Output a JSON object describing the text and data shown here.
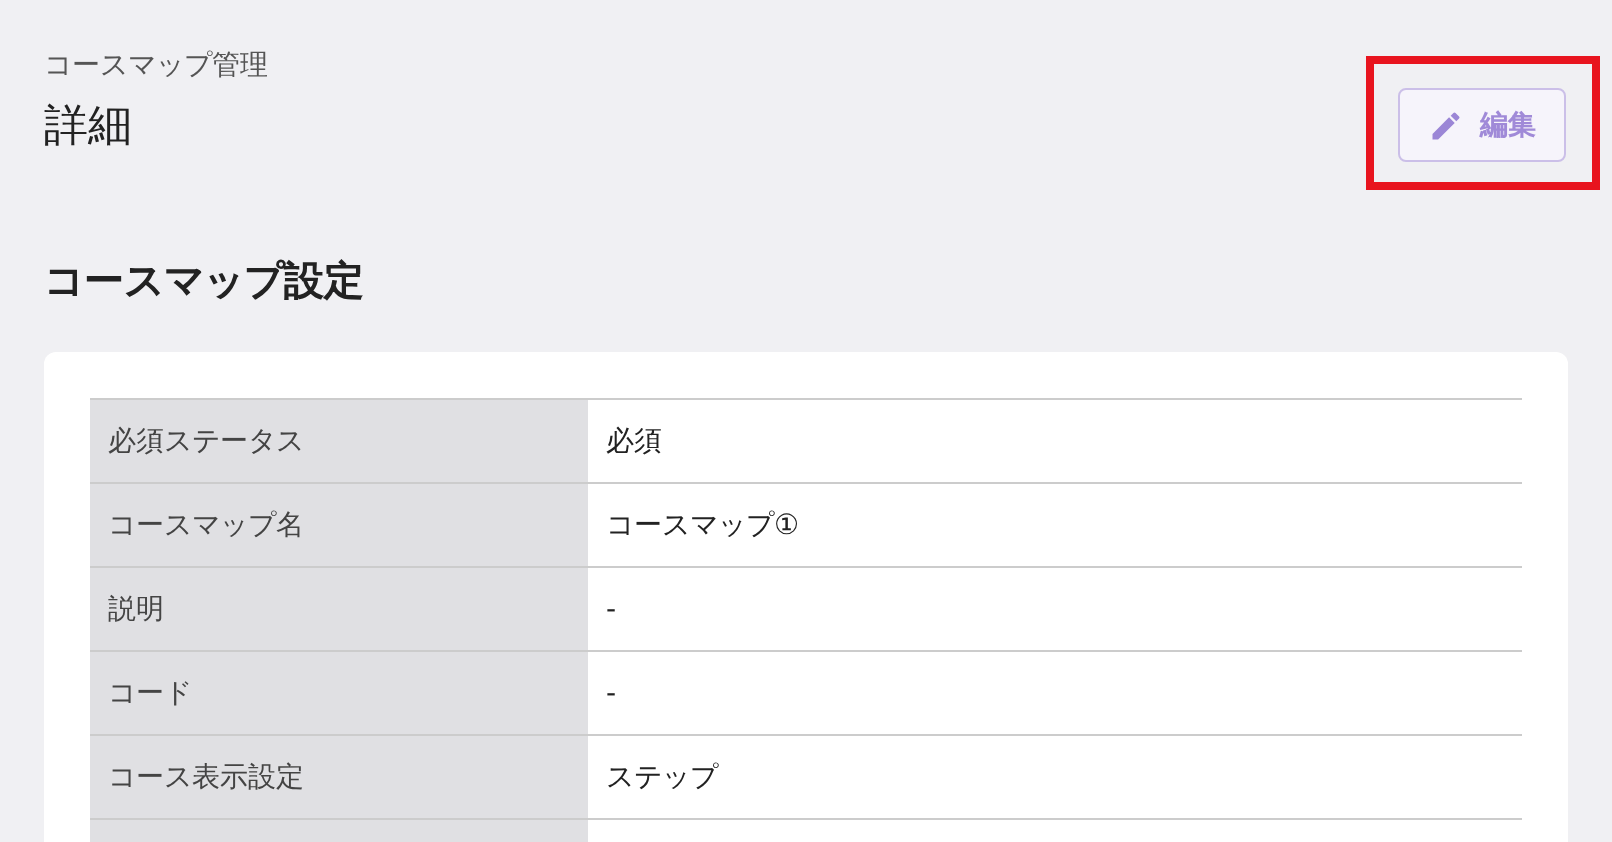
{
  "breadcrumb": "コースマップ管理",
  "page_title": "詳細",
  "edit_button": {
    "label": "編集"
  },
  "section": {
    "title": "コースマップ設定",
    "rows": [
      {
        "label": "必須ステータス",
        "value": "必須"
      },
      {
        "label": "コースマップ名",
        "value": "コースマップ①"
      },
      {
        "label": "説明",
        "value": "-"
      },
      {
        "label": "コード",
        "value": "-"
      },
      {
        "label": "コース表示設定",
        "value": "ステップ"
      }
    ]
  }
}
